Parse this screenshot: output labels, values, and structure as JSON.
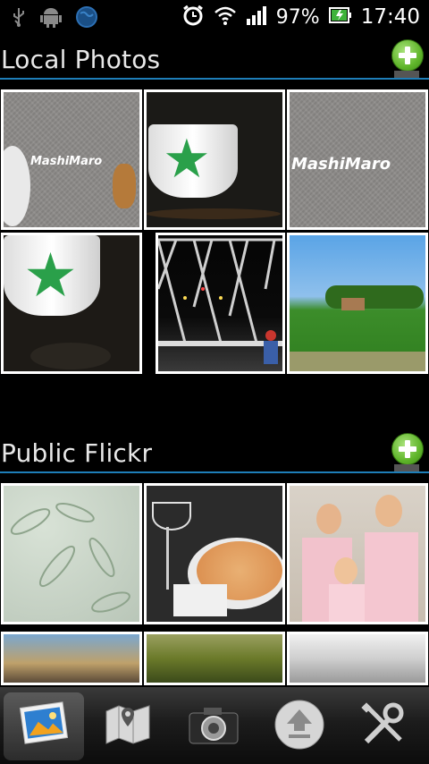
{
  "status_bar": {
    "icons_left": [
      "usb-icon",
      "android-debug-icon",
      "globe-icon"
    ],
    "icons_right": [
      "alarm-icon",
      "wifi-icon",
      "signal-icon",
      "battery-charging-icon"
    ],
    "battery_percent": "97%",
    "time": "17:40"
  },
  "sections": [
    {
      "title": "Local Photos",
      "add_icon": "add-icon"
    },
    {
      "title": "Public Flickr",
      "add_icon": "add-icon"
    }
  ],
  "local_photos": [
    {
      "description_icon": "photo-thumbnail",
      "watermark": "MashiMaro"
    },
    {
      "description_icon": "photo-thumbnail"
    },
    {
      "description_icon": "photo-thumbnail",
      "watermark": "MashiMaro"
    },
    {
      "description_icon": "photo-thumbnail"
    },
    {
      "description_icon": "photo-thumbnail"
    },
    {
      "description_icon": "photo-thumbnail"
    }
  ],
  "flickr_photos": [
    {
      "description_icon": "photo-thumbnail"
    },
    {
      "description_icon": "photo-thumbnail"
    },
    {
      "description_icon": "photo-thumbnail"
    },
    {
      "description_icon": "photo-thumbnail"
    },
    {
      "description_icon": "photo-thumbnail"
    },
    {
      "description_icon": "photo-thumbnail"
    }
  ],
  "bottom_tabs": [
    {
      "icon": "gallery-icon",
      "active": true
    },
    {
      "icon": "map-icon",
      "active": false
    },
    {
      "icon": "camera-icon",
      "active": false
    },
    {
      "icon": "upload-icon",
      "active": false
    },
    {
      "icon": "settings-tools-icon",
      "active": false
    }
  ],
  "colors": {
    "accent_line": "#1e7eb8",
    "add_button_green": "#5fb52a",
    "background": "#000000"
  }
}
